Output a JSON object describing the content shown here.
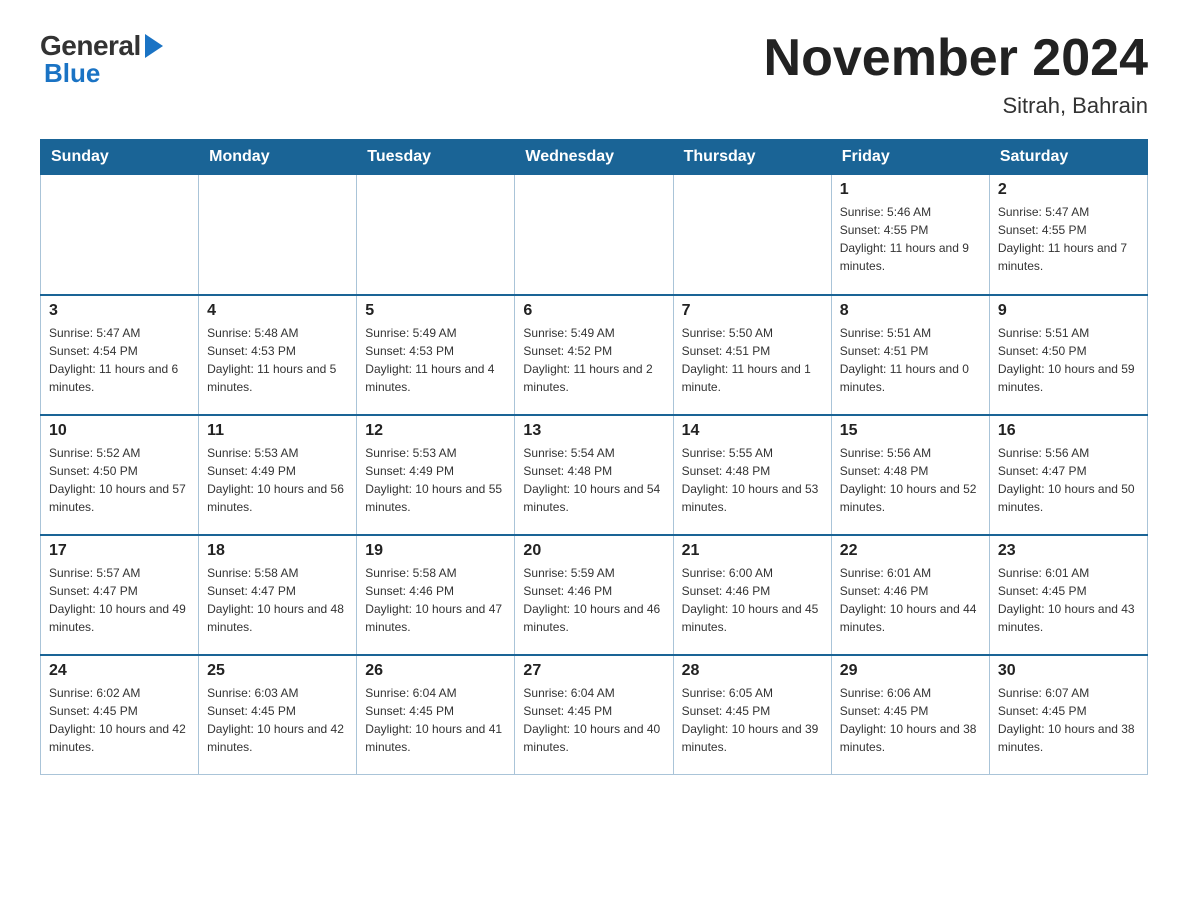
{
  "logo": {
    "text_general": "General",
    "text_blue": "Blue"
  },
  "title": "November 2024",
  "subtitle": "Sitrah, Bahrain",
  "days_of_week": [
    "Sunday",
    "Monday",
    "Tuesday",
    "Wednesday",
    "Thursday",
    "Friday",
    "Saturday"
  ],
  "weeks": [
    [
      {
        "day": "",
        "detail": ""
      },
      {
        "day": "",
        "detail": ""
      },
      {
        "day": "",
        "detail": ""
      },
      {
        "day": "",
        "detail": ""
      },
      {
        "day": "",
        "detail": ""
      },
      {
        "day": "1",
        "detail": "Sunrise: 5:46 AM\nSunset: 4:55 PM\nDaylight: 11 hours and 9 minutes."
      },
      {
        "day": "2",
        "detail": "Sunrise: 5:47 AM\nSunset: 4:55 PM\nDaylight: 11 hours and 7 minutes."
      }
    ],
    [
      {
        "day": "3",
        "detail": "Sunrise: 5:47 AM\nSunset: 4:54 PM\nDaylight: 11 hours and 6 minutes."
      },
      {
        "day": "4",
        "detail": "Sunrise: 5:48 AM\nSunset: 4:53 PM\nDaylight: 11 hours and 5 minutes."
      },
      {
        "day": "5",
        "detail": "Sunrise: 5:49 AM\nSunset: 4:53 PM\nDaylight: 11 hours and 4 minutes."
      },
      {
        "day": "6",
        "detail": "Sunrise: 5:49 AM\nSunset: 4:52 PM\nDaylight: 11 hours and 2 minutes."
      },
      {
        "day": "7",
        "detail": "Sunrise: 5:50 AM\nSunset: 4:51 PM\nDaylight: 11 hours and 1 minute."
      },
      {
        "day": "8",
        "detail": "Sunrise: 5:51 AM\nSunset: 4:51 PM\nDaylight: 11 hours and 0 minutes."
      },
      {
        "day": "9",
        "detail": "Sunrise: 5:51 AM\nSunset: 4:50 PM\nDaylight: 10 hours and 59 minutes."
      }
    ],
    [
      {
        "day": "10",
        "detail": "Sunrise: 5:52 AM\nSunset: 4:50 PM\nDaylight: 10 hours and 57 minutes."
      },
      {
        "day": "11",
        "detail": "Sunrise: 5:53 AM\nSunset: 4:49 PM\nDaylight: 10 hours and 56 minutes."
      },
      {
        "day": "12",
        "detail": "Sunrise: 5:53 AM\nSunset: 4:49 PM\nDaylight: 10 hours and 55 minutes."
      },
      {
        "day": "13",
        "detail": "Sunrise: 5:54 AM\nSunset: 4:48 PM\nDaylight: 10 hours and 54 minutes."
      },
      {
        "day": "14",
        "detail": "Sunrise: 5:55 AM\nSunset: 4:48 PM\nDaylight: 10 hours and 53 minutes."
      },
      {
        "day": "15",
        "detail": "Sunrise: 5:56 AM\nSunset: 4:48 PM\nDaylight: 10 hours and 52 minutes."
      },
      {
        "day": "16",
        "detail": "Sunrise: 5:56 AM\nSunset: 4:47 PM\nDaylight: 10 hours and 50 minutes."
      }
    ],
    [
      {
        "day": "17",
        "detail": "Sunrise: 5:57 AM\nSunset: 4:47 PM\nDaylight: 10 hours and 49 minutes."
      },
      {
        "day": "18",
        "detail": "Sunrise: 5:58 AM\nSunset: 4:47 PM\nDaylight: 10 hours and 48 minutes."
      },
      {
        "day": "19",
        "detail": "Sunrise: 5:58 AM\nSunset: 4:46 PM\nDaylight: 10 hours and 47 minutes."
      },
      {
        "day": "20",
        "detail": "Sunrise: 5:59 AM\nSunset: 4:46 PM\nDaylight: 10 hours and 46 minutes."
      },
      {
        "day": "21",
        "detail": "Sunrise: 6:00 AM\nSunset: 4:46 PM\nDaylight: 10 hours and 45 minutes."
      },
      {
        "day": "22",
        "detail": "Sunrise: 6:01 AM\nSunset: 4:46 PM\nDaylight: 10 hours and 44 minutes."
      },
      {
        "day": "23",
        "detail": "Sunrise: 6:01 AM\nSunset: 4:45 PM\nDaylight: 10 hours and 43 minutes."
      }
    ],
    [
      {
        "day": "24",
        "detail": "Sunrise: 6:02 AM\nSunset: 4:45 PM\nDaylight: 10 hours and 42 minutes."
      },
      {
        "day": "25",
        "detail": "Sunrise: 6:03 AM\nSunset: 4:45 PM\nDaylight: 10 hours and 42 minutes."
      },
      {
        "day": "26",
        "detail": "Sunrise: 6:04 AM\nSunset: 4:45 PM\nDaylight: 10 hours and 41 minutes."
      },
      {
        "day": "27",
        "detail": "Sunrise: 6:04 AM\nSunset: 4:45 PM\nDaylight: 10 hours and 40 minutes."
      },
      {
        "day": "28",
        "detail": "Sunrise: 6:05 AM\nSunset: 4:45 PM\nDaylight: 10 hours and 39 minutes."
      },
      {
        "day": "29",
        "detail": "Sunrise: 6:06 AM\nSunset: 4:45 PM\nDaylight: 10 hours and 38 minutes."
      },
      {
        "day": "30",
        "detail": "Sunrise: 6:07 AM\nSunset: 4:45 PM\nDaylight: 10 hours and 38 minutes."
      }
    ]
  ]
}
